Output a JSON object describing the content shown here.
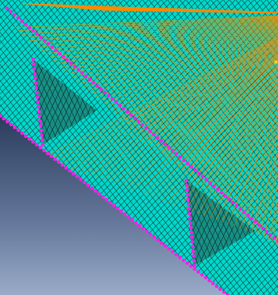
{
  "viewport": {
    "background_top": "#1c2a45",
    "background_bottom": "#9aabc8"
  },
  "mesh": {
    "shell_color": "#00d8cc",
    "shell_shadow_color": "#1a8a7e",
    "element_edge_color": "#0d2a28",
    "boundary_node_color": "#ff1ee8",
    "spoke_color": "#ff8a00",
    "spoke_alt_color": "#c8a000",
    "marker_color": "#ffd400"
  }
}
